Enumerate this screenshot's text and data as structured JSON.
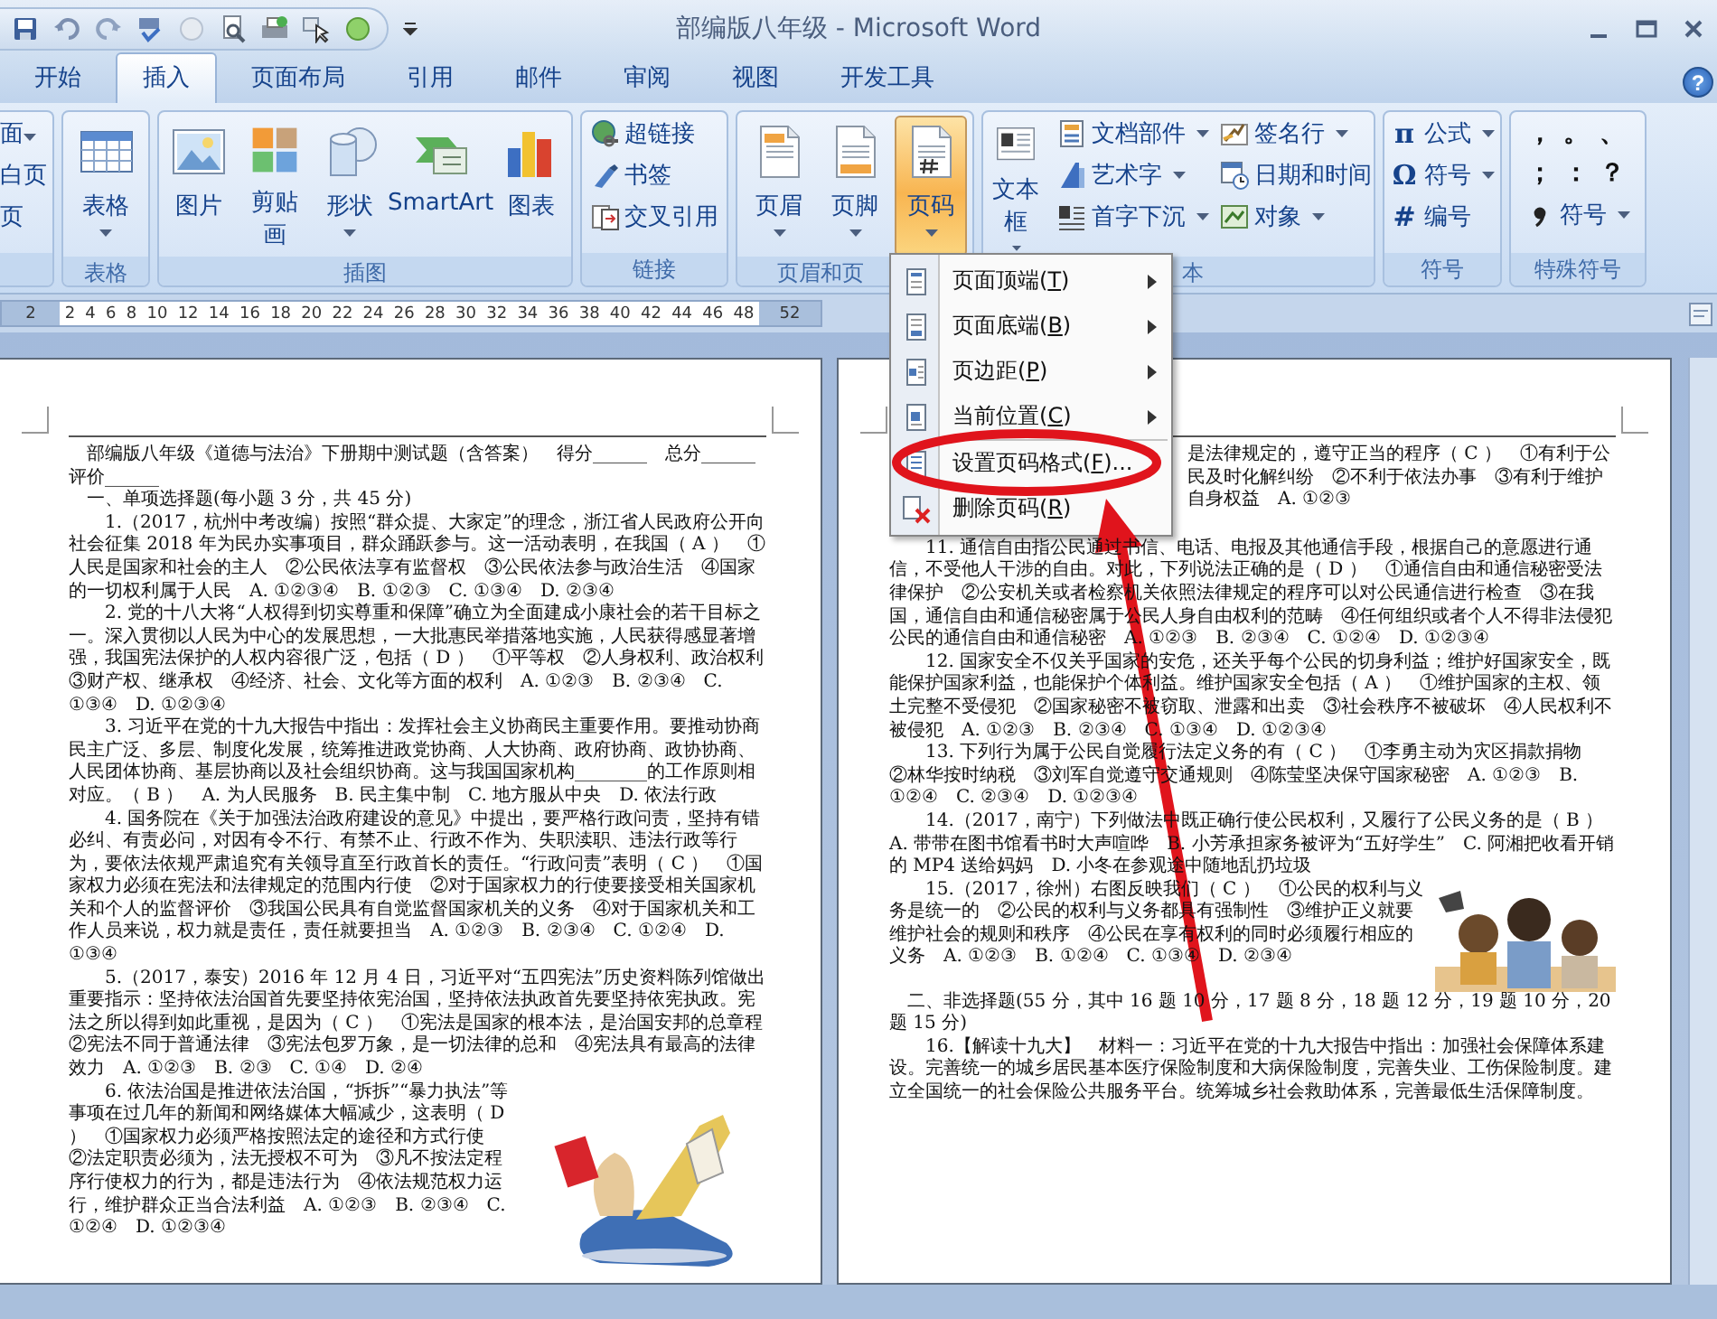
{
  "window": {
    "title": "部编版八年级 - Microsoft Word",
    "help": "?"
  },
  "tabs": [
    {
      "label": "开始",
      "selected": false
    },
    {
      "label": "插入",
      "selected": true
    },
    {
      "label": "页面布局",
      "selected": false
    },
    {
      "label": "引用",
      "selected": false
    },
    {
      "label": "邮件",
      "selected": false
    },
    {
      "label": "审阅",
      "selected": false
    },
    {
      "label": "视图",
      "selected": false
    },
    {
      "label": "开发工具",
      "selected": false
    }
  ],
  "ribbon": {
    "groups": [
      {
        "items": [
          {
            "kind": "text",
            "label": "面",
            "dropdown": true
          },
          {
            "kind": "text",
            "label": "白页",
            "dropdown": false
          },
          {
            "kind": "text",
            "label": "页",
            "dropdown": false
          }
        ]
      },
      {
        "label": "表格",
        "items": [
          {
            "kind": "large",
            "label": "表格",
            "dropdown": true,
            "pressed": false
          }
        ]
      },
      {
        "label": "插图",
        "items": [
          {
            "kind": "large",
            "label": "图片",
            "dropdown": false,
            "pressed": false
          },
          {
            "kind": "large",
            "label": "剪贴画",
            "dropdown": false,
            "pressed": false
          },
          {
            "kind": "large",
            "label": "形状",
            "dropdown": true,
            "pressed": false
          },
          {
            "kind": "large",
            "label": "SmartArt",
            "dropdown": false,
            "pressed": false
          },
          {
            "kind": "large",
            "label": "图表",
            "dropdown": false,
            "pressed": false
          }
        ]
      },
      {
        "label": "链接",
        "items": [
          {
            "kind": "small",
            "label": "超链接",
            "dropdown": false
          },
          {
            "kind": "small",
            "label": "书签",
            "dropdown": false
          },
          {
            "kind": "small",
            "label": "交叉引用",
            "dropdown": false
          }
        ]
      },
      {
        "label": "页眉和页",
        "items": [
          {
            "kind": "large",
            "label": "页眉",
            "dropdown": true,
            "pressed": false
          },
          {
            "kind": "large",
            "label": "页脚",
            "dropdown": true,
            "pressed": false
          },
          {
            "kind": "large",
            "label": "页码",
            "dropdown": true,
            "pressed": true
          }
        ]
      },
      {
        "label": "本",
        "items": [
          {
            "kind": "large",
            "label": "文本框",
            "dropdown": true,
            "pressed": false
          },
          {
            "kind": "small",
            "label": "文档部件",
            "dropdown": true
          },
          {
            "kind": "small",
            "label": "艺术字",
            "dropdown": true
          },
          {
            "kind": "small",
            "label": "首字下沉",
            "dropdown": true
          },
          {
            "kind": "small",
            "label": "签名行",
            "dropdown": true
          },
          {
            "kind": "small",
            "label": "日期和时间",
            "dropdown": false
          },
          {
            "kind": "small",
            "label": "对象",
            "dropdown": true
          }
        ]
      },
      {
        "label": "符号",
        "items": [
          {
            "kind": "small",
            "glyph": "π",
            "label": "公式",
            "dropdown": true
          },
          {
            "kind": "small",
            "glyph": "Ω",
            "label": "符号",
            "dropdown": true
          },
          {
            "kind": "small",
            "glyph": "#",
            "label": "编号",
            "dropdown": false
          }
        ]
      },
      {
        "label": "特殊符号",
        "items": [
          {
            "kind": "glyph",
            "label": "，"
          },
          {
            "kind": "glyph",
            "label": "。"
          },
          {
            "kind": "glyph",
            "label": "、"
          },
          {
            "kind": "glyph",
            "label": "；"
          },
          {
            "kind": "glyph",
            "label": "："
          },
          {
            "kind": "glyph",
            "label": "？"
          },
          {
            "kind": "small",
            "label": "符号",
            "dropdown": true
          }
        ]
      }
    ]
  },
  "ruler": {
    "numbers": [
      "2",
      "2",
      "4",
      "6",
      "8",
      "10",
      "12",
      "14",
      "16",
      "18",
      "20",
      "22",
      "24",
      "26",
      "28",
      "30",
      "32",
      "34",
      "36",
      "38",
      "40",
      "42",
      "44",
      "46",
      "48",
      "52"
    ]
  },
  "menu": {
    "items": [
      {
        "before": "页面顶端(",
        "key": "T",
        "after": ")",
        "submenu": true,
        "divider": false
      },
      {
        "before": "页面底端(",
        "key": "B",
        "after": ")",
        "submenu": true,
        "divider": false
      },
      {
        "before": "页边距(",
        "key": "P",
        "after": ")",
        "submenu": true,
        "divider": false
      },
      {
        "before": "当前位置(",
        "key": "C",
        "after": ")",
        "submenu": true,
        "divider": false
      },
      {
        "before": "设置页码格式(",
        "key": "F",
        "after": ")...",
        "submenu": false,
        "divider": true
      },
      {
        "before": "删除页码(",
        "key": "R",
        "after": ")",
        "submenu": false,
        "divider": false
      }
    ]
  },
  "pages": [
    {
      "paragraphs": [
        {
          "kind": "title",
          "text": "部编版八年级《道德与法治》下册期中测试题（含答案）　得分______　总分______　评价______"
        },
        {
          "kind": "heading",
          "text": "一、单项选择题(每小题 3 分，共 45 分)"
        },
        {
          "kind": "text",
          "text": "1.（2017，杭州中考改编）按照“群众提、大家定”的理念，浙江省人民政府公开向社会征集 2018 年为民办实事项目，群众踊跃参与。这一活动表明，在我国（ A ）　①人民是国家和社会的主人　②公民依法享有监督权　③公民依法参与政治生活　④国家的一切权利属于人民　A. ①②③④　B. ①②③　C. ①③④　D. ②③④"
        },
        {
          "kind": "text",
          "text": "2. 党的十八大将“人权得到切实尊重和保障”确立为全面建成小康社会的若干目标之一。深入贯彻以人民为中心的发展思想，一大批惠民举措落地实施，人民获得感显著增强，我国宪法保护的人权内容很广泛，包括（ D ）　①平等权　②人身权利、政治权利　③财产权、继承权　④经济、社会、文化等方面的权利　A. ①②③　B. ②③④　C. ①③④　D. ①②③④"
        },
        {
          "kind": "text",
          "text": "3. 习近平在党的十九大报告中指出：发挥社会主义协商民主重要作用。要推动协商民主广泛、多层、制度化发展，统筹推进政党协商、人大协商、政府协商、政协协商、人民团体协商、基层协商以及社会组织协商。这与我国国家机构________的工作原则相对应。（ B ）　A. 为人民服务　B. 民主集中制　C. 地方服从中央　D. 依法行政"
        },
        {
          "kind": "text",
          "text": "4. 国务院在《关于加强法治政府建设的意见》中提出，要严格行政问责，坚持有错必纠、有责必问，对因有令不行、有禁不止、行政不作为、失职渎职、违法行政等行为，要依法依规严肃追究有关领导直至行政首长的责任。“行政问责”表明（ C ）　①国家权力必须在宪法和法律规定的范围内行使　②对于国家权力的行使要接受相关国家机关和个人的监督评价　③我国公民具有自觉监督国家机关的义务　④对于国家机关和工作人员来说，权力就是责任，责任就要担当　A. ①②③　B. ②③④　C. ①②④　D. ①③④"
        },
        {
          "kind": "text",
          "text": "5.（2017，泰安）2016 年 12 月 4 日，习近平对“五四宪法”历史资料陈列馆做出重要指示：坚持依法治国首先要坚持依宪治国，坚持依法执政首先要坚持依宪执政。宪法之所以得到如此重视，是因为（ C ）　①宪法是国家的根本法，是治国安邦的总章程　②宪法不同于普通法律　③宪法包罗万象，是一切法律的总和　④宪法具有最高的法律效力　A. ①②③　B. ②③　C. ①④　D. ②④"
        },
        {
          "kind": "text",
          "text": "6. 依法治国是推进依法治国，“拆拆”“暴力执法”等事项在过几年的新闻和网络媒体大幅减少，这表明（ D ）　①国家权力必须严格按照法定的途径和方式行使　②法定职责必须为，法无授权不可为　③凡不按法定程序行使权力的行为，都是违法行为　④依法规范权力运行，维护群众正当合法利益　A. ①②③　B. ②③④　C. ①②④　D. ①②③④"
        }
      ]
    },
    {
      "paragraphs": [
        {
          "kind": "fragment",
          "text": "是法律规定的，遵守正当的程序（ C ）　①有利于公民及时化解纠纷　②不利于依法办事　③有利于维护自身权益　A. ①②③"
        },
        {
          "kind": "text",
          "text": "11. 通信自由指公民通过书信、电话、电报及其他通信手段，根据自己的意愿进行通信，不受他人干涉的自由。对此，下列说法正确的是（ D ）　①通信自由和通信秘密受法律保护　②公安机关或者检察机关依照法律规定的程序可以对公民通信进行检查　③在我国，通信自由和通信秘密属于公民人身自由权利的范畴　④任何组织或者个人不得非法侵犯公民的通信自由和通信秘密　A. ①②③　B. ②③④　C. ①②④　D. ①②③④"
        },
        {
          "kind": "text",
          "text": "12. 国家安全不仅关乎国家的安危，还关乎每个公民的切身利益；维护好国家安全，既能保护国家利益，也能保护个体利益。维护国家安全包括（ A ）　①维护国家的主权、领土完整不受侵犯　②国家秘密不被窃取、泄露和出卖　③社会秩序不被破坏　④人民权利不被侵犯　A. ①②③　B. ②③④　C. ①③④　D. ①②③④"
        },
        {
          "kind": "text",
          "text": "13. 下列行为属于公民自觉履行法定义务的有（ C ）　①李勇主动为灾区捐款捐物　②林华按时纳税　③刘军自觉遵守交通规则　④陈莹坚决保守国家秘密　A. ①②③　B. ①②④　C. ②③④　D. ①②③④"
        },
        {
          "kind": "text",
          "text": "14.（2017，南宁）下列做法中既正确行使公民权利，又履行了公民义务的是（ B ）　A. 带带在图书馆看书时大声喧哗　B. 小芳承担家务被评为“五好学生”　C. 阿湘把收看开销的 MP4 送给妈妈　D. 小冬在参观途中随地乱扔垃圾"
        },
        {
          "kind": "text",
          "text": "15.（2017，徐州）右图反映我们（ C ）　①公民的权利与义务是统一的　②公民的权利与义务都具有强制性　③维护正义就要维护社会的规则和秩序　④公民在享有权利的同时必须履行相应的义务　A. ①②③　B. ①②④　C. ①③④　D. ②③④"
        },
        {
          "kind": "heading",
          "text": "二、非选择题(55 分，其中 16 题 10 分，17 题 8 分，18 题 12 分，19 题 10 分，20 题 15 分)"
        },
        {
          "kind": "text",
          "text": "16.【解读十九大】　材料一：习近平在党的十九大报告中指出：加强社会保障体系建设。完善统一的城乡居民基本医疗保险制度和大病保险制度，完善失业、工伤保险制度。建立全国统一的社会保险公共服务平台。统筹城乡社会救助体系，完善最低生活保障制度。"
        }
      ]
    }
  ]
}
